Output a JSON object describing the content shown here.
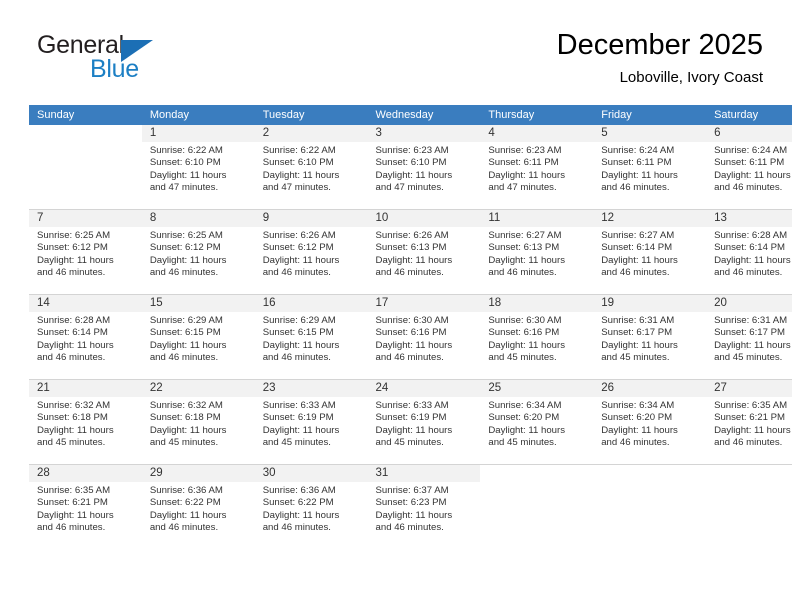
{
  "logo": {
    "word1": "General",
    "word2": "Blue",
    "triangle_color": "#1c6fb5",
    "blue_color": "#1c7fc4"
  },
  "header": {
    "title": "December 2025",
    "subtitle": "Loboville, Ivory Coast"
  },
  "theme": {
    "header_row_bg": "#3a7dbf",
    "header_row_text": "#ffffff",
    "daynum_band_bg": "#f2f2f2",
    "row_divider": "#d4d4d4",
    "body_text": "#333333"
  },
  "calendar": {
    "weekday_headers": [
      "Sunday",
      "Monday",
      "Tuesday",
      "Wednesday",
      "Thursday",
      "Friday",
      "Saturday"
    ],
    "weeks": [
      [
        {
          "day": "",
          "sunrise": "",
          "sunset": "",
          "daylight_line1": "",
          "daylight_line2": ""
        },
        {
          "day": "1",
          "sunrise": "Sunrise: 6:22 AM",
          "sunset": "Sunset: 6:10 PM",
          "daylight_line1": "Daylight: 11 hours",
          "daylight_line2": "and 47 minutes."
        },
        {
          "day": "2",
          "sunrise": "Sunrise: 6:22 AM",
          "sunset": "Sunset: 6:10 PM",
          "daylight_line1": "Daylight: 11 hours",
          "daylight_line2": "and 47 minutes."
        },
        {
          "day": "3",
          "sunrise": "Sunrise: 6:23 AM",
          "sunset": "Sunset: 6:10 PM",
          "daylight_line1": "Daylight: 11 hours",
          "daylight_line2": "and 47 minutes."
        },
        {
          "day": "4",
          "sunrise": "Sunrise: 6:23 AM",
          "sunset": "Sunset: 6:11 PM",
          "daylight_line1": "Daylight: 11 hours",
          "daylight_line2": "and 47 minutes."
        },
        {
          "day": "5",
          "sunrise": "Sunrise: 6:24 AM",
          "sunset": "Sunset: 6:11 PM",
          "daylight_line1": "Daylight: 11 hours",
          "daylight_line2": "and 46 minutes."
        },
        {
          "day": "6",
          "sunrise": "Sunrise: 6:24 AM",
          "sunset": "Sunset: 6:11 PM",
          "daylight_line1": "Daylight: 11 hours",
          "daylight_line2": "and 46 minutes."
        }
      ],
      [
        {
          "day": "7",
          "sunrise": "Sunrise: 6:25 AM",
          "sunset": "Sunset: 6:12 PM",
          "daylight_line1": "Daylight: 11 hours",
          "daylight_line2": "and 46 minutes."
        },
        {
          "day": "8",
          "sunrise": "Sunrise: 6:25 AM",
          "sunset": "Sunset: 6:12 PM",
          "daylight_line1": "Daylight: 11 hours",
          "daylight_line2": "and 46 minutes."
        },
        {
          "day": "9",
          "sunrise": "Sunrise: 6:26 AM",
          "sunset": "Sunset: 6:12 PM",
          "daylight_line1": "Daylight: 11 hours",
          "daylight_line2": "and 46 minutes."
        },
        {
          "day": "10",
          "sunrise": "Sunrise: 6:26 AM",
          "sunset": "Sunset: 6:13 PM",
          "daylight_line1": "Daylight: 11 hours",
          "daylight_line2": "and 46 minutes."
        },
        {
          "day": "11",
          "sunrise": "Sunrise: 6:27 AM",
          "sunset": "Sunset: 6:13 PM",
          "daylight_line1": "Daylight: 11 hours",
          "daylight_line2": "and 46 minutes."
        },
        {
          "day": "12",
          "sunrise": "Sunrise: 6:27 AM",
          "sunset": "Sunset: 6:14 PM",
          "daylight_line1": "Daylight: 11 hours",
          "daylight_line2": "and 46 minutes."
        },
        {
          "day": "13",
          "sunrise": "Sunrise: 6:28 AM",
          "sunset": "Sunset: 6:14 PM",
          "daylight_line1": "Daylight: 11 hours",
          "daylight_line2": "and 46 minutes."
        }
      ],
      [
        {
          "day": "14",
          "sunrise": "Sunrise: 6:28 AM",
          "sunset": "Sunset: 6:14 PM",
          "daylight_line1": "Daylight: 11 hours",
          "daylight_line2": "and 46 minutes."
        },
        {
          "day": "15",
          "sunrise": "Sunrise: 6:29 AM",
          "sunset": "Sunset: 6:15 PM",
          "daylight_line1": "Daylight: 11 hours",
          "daylight_line2": "and 46 minutes."
        },
        {
          "day": "16",
          "sunrise": "Sunrise: 6:29 AM",
          "sunset": "Sunset: 6:15 PM",
          "daylight_line1": "Daylight: 11 hours",
          "daylight_line2": "and 46 minutes."
        },
        {
          "day": "17",
          "sunrise": "Sunrise: 6:30 AM",
          "sunset": "Sunset: 6:16 PM",
          "daylight_line1": "Daylight: 11 hours",
          "daylight_line2": "and 46 minutes."
        },
        {
          "day": "18",
          "sunrise": "Sunrise: 6:30 AM",
          "sunset": "Sunset: 6:16 PM",
          "daylight_line1": "Daylight: 11 hours",
          "daylight_line2": "and 45 minutes."
        },
        {
          "day": "19",
          "sunrise": "Sunrise: 6:31 AM",
          "sunset": "Sunset: 6:17 PM",
          "daylight_line1": "Daylight: 11 hours",
          "daylight_line2": "and 45 minutes."
        },
        {
          "day": "20",
          "sunrise": "Sunrise: 6:31 AM",
          "sunset": "Sunset: 6:17 PM",
          "daylight_line1": "Daylight: 11 hours",
          "daylight_line2": "and 45 minutes."
        }
      ],
      [
        {
          "day": "21",
          "sunrise": "Sunrise: 6:32 AM",
          "sunset": "Sunset: 6:18 PM",
          "daylight_line1": "Daylight: 11 hours",
          "daylight_line2": "and 45 minutes."
        },
        {
          "day": "22",
          "sunrise": "Sunrise: 6:32 AM",
          "sunset": "Sunset: 6:18 PM",
          "daylight_line1": "Daylight: 11 hours",
          "daylight_line2": "and 45 minutes."
        },
        {
          "day": "23",
          "sunrise": "Sunrise: 6:33 AM",
          "sunset": "Sunset: 6:19 PM",
          "daylight_line1": "Daylight: 11 hours",
          "daylight_line2": "and 45 minutes."
        },
        {
          "day": "24",
          "sunrise": "Sunrise: 6:33 AM",
          "sunset": "Sunset: 6:19 PM",
          "daylight_line1": "Daylight: 11 hours",
          "daylight_line2": "and 45 minutes."
        },
        {
          "day": "25",
          "sunrise": "Sunrise: 6:34 AM",
          "sunset": "Sunset: 6:20 PM",
          "daylight_line1": "Daylight: 11 hours",
          "daylight_line2": "and 45 minutes."
        },
        {
          "day": "26",
          "sunrise": "Sunrise: 6:34 AM",
          "sunset": "Sunset: 6:20 PM",
          "daylight_line1": "Daylight: 11 hours",
          "daylight_line2": "and 46 minutes."
        },
        {
          "day": "27",
          "sunrise": "Sunrise: 6:35 AM",
          "sunset": "Sunset: 6:21 PM",
          "daylight_line1": "Daylight: 11 hours",
          "daylight_line2": "and 46 minutes."
        }
      ],
      [
        {
          "day": "28",
          "sunrise": "Sunrise: 6:35 AM",
          "sunset": "Sunset: 6:21 PM",
          "daylight_line1": "Daylight: 11 hours",
          "daylight_line2": "and 46 minutes."
        },
        {
          "day": "29",
          "sunrise": "Sunrise: 6:36 AM",
          "sunset": "Sunset: 6:22 PM",
          "daylight_line1": "Daylight: 11 hours",
          "daylight_line2": "and 46 minutes."
        },
        {
          "day": "30",
          "sunrise": "Sunrise: 6:36 AM",
          "sunset": "Sunset: 6:22 PM",
          "daylight_line1": "Daylight: 11 hours",
          "daylight_line2": "and 46 minutes."
        },
        {
          "day": "31",
          "sunrise": "Sunrise: 6:37 AM",
          "sunset": "Sunset: 6:23 PM",
          "daylight_line1": "Daylight: 11 hours",
          "daylight_line2": "and 46 minutes."
        },
        {
          "day": "",
          "sunrise": "",
          "sunset": "",
          "daylight_line1": "",
          "daylight_line2": ""
        },
        {
          "day": "",
          "sunrise": "",
          "sunset": "",
          "daylight_line1": "",
          "daylight_line2": ""
        },
        {
          "day": "",
          "sunrise": "",
          "sunset": "",
          "daylight_line1": "",
          "daylight_line2": ""
        }
      ]
    ]
  }
}
